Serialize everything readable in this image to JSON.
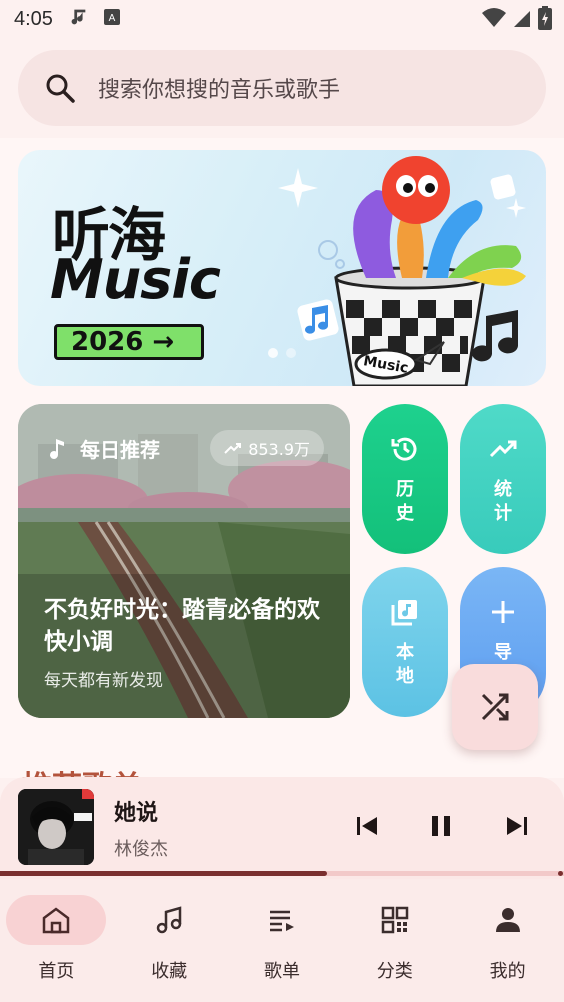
{
  "status_bar": {
    "time": "4:05"
  },
  "search": {
    "placeholder": "搜索你想搜的音乐或歌手"
  },
  "banner": {
    "title_cn": "听海",
    "title_en": "Music",
    "year": "2026 →",
    "cup_label": "Music"
  },
  "daily": {
    "label": "每日推荐",
    "play_count": "853.9万",
    "title": "不负好时光：踏青必备的欢快小调",
    "subtitle": "每天都有新发现"
  },
  "tiles": [
    {
      "label": "历史",
      "icon": "history-icon",
      "color": "#18c884"
    },
    {
      "label": "统计",
      "icon": "trending-up-icon",
      "color": "#44d2c2"
    },
    {
      "label": "本地",
      "icon": "library-music-icon",
      "color": "#6dcbe8"
    },
    {
      "label": "导入",
      "icon": "plus-icon",
      "color": "#6aa9f2"
    }
  ],
  "section_peek": "推荐歌单",
  "player": {
    "title": "她说",
    "artist": "林俊杰",
    "progress": 0.58
  },
  "nav": [
    {
      "label": "首页",
      "icon": "home-icon",
      "active": true
    },
    {
      "label": "收藏",
      "icon": "music-notes-icon",
      "active": false
    },
    {
      "label": "歌单",
      "icon": "playlist-icon",
      "active": false
    },
    {
      "label": "分类",
      "icon": "grid-icon",
      "active": false
    },
    {
      "label": "我的",
      "icon": "person-icon",
      "active": false
    }
  ]
}
